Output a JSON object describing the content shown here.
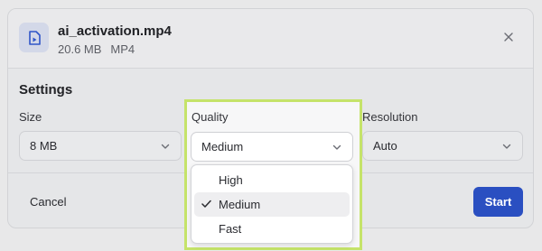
{
  "file": {
    "name": "ai_activation.mp4",
    "size": "20.6 MB",
    "format": "MP4"
  },
  "settings": {
    "title": "Settings",
    "size": {
      "label": "Size",
      "value": "8 MB"
    },
    "quality": {
      "label": "Quality",
      "value": "Medium",
      "options": [
        "High",
        "Medium",
        "Fast"
      ],
      "selected_index": 1
    },
    "resolution": {
      "label": "Resolution",
      "value": "Auto"
    }
  },
  "footer": {
    "cancel_label": "Cancel",
    "start_label": "Start"
  },
  "colors": {
    "accent": "#2a4fc1",
    "highlight_border": "#c5e36a"
  },
  "icons": {
    "file": "video-file-icon",
    "close": "close-icon",
    "dropdown": "chevron-down-icon",
    "selected": "check-icon"
  }
}
